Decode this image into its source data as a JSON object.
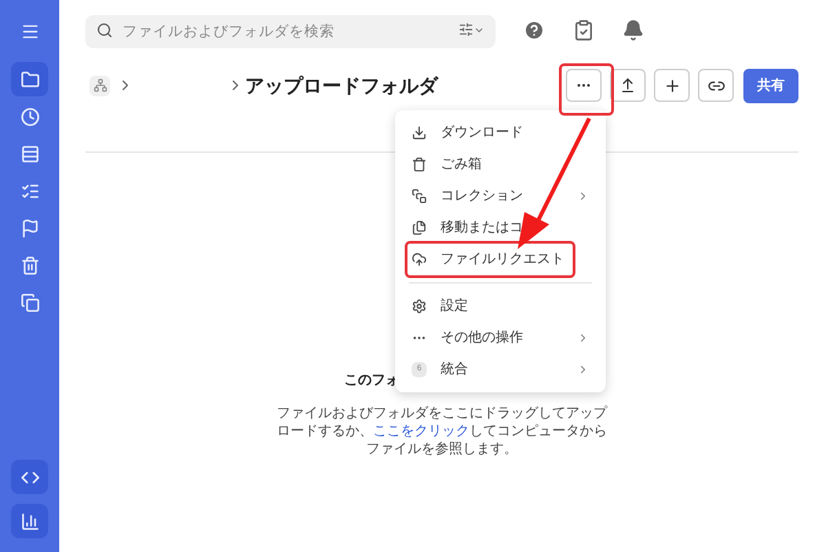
{
  "sidebar": {
    "items": [
      {
        "kind": "folder",
        "selected": true
      },
      {
        "kind": "clock",
        "selected": false
      },
      {
        "kind": "rows",
        "selected": false
      },
      {
        "kind": "list",
        "selected": false
      },
      {
        "kind": "flags",
        "selected": false
      },
      {
        "kind": "bin",
        "selected": false
      },
      {
        "kind": "copy",
        "selected": false
      }
    ],
    "bottom_items": [
      {
        "kind": "code"
      },
      {
        "kind": "chart"
      }
    ]
  },
  "search": {
    "placeholder": "ファイルおよびフォルダを検索"
  },
  "header": {
    "title": "アップロードフォルダ",
    "share_button": "共有"
  },
  "menu": {
    "items": [
      {
        "kind": "download",
        "label": "ダウンロード",
        "submenu": false,
        "highlighted": false
      },
      {
        "kind": "bin",
        "label": "ごみ箱",
        "submenu": false,
        "highlighted": false
      },
      {
        "kind": "collection",
        "label": "コレクション",
        "submenu": true,
        "highlighted": false
      },
      {
        "kind": "copy",
        "label": "移動またはコ",
        "submenu": false,
        "highlighted": false
      },
      {
        "kind": "upload",
        "label": "ファイルリクエスト",
        "submenu": false,
        "highlighted": true
      },
      {
        "kind": "divider"
      },
      {
        "kind": "gear",
        "label": "設定",
        "submenu": false,
        "highlighted": false
      },
      {
        "kind": "dots",
        "label": "その他の操作",
        "submenu": true,
        "highlighted": false
      },
      {
        "kind": "badge",
        "badge": "6",
        "label": "統合",
        "submenu": true,
        "highlighted": false
      }
    ]
  },
  "empty_state": {
    "title": "このフォ",
    "text_before": "ファイルおよびフォルダをここにドラッグしてアップロードするか、",
    "link": "ここをクリック",
    "text_after": "してコンピュータからファイルを参照します。"
  }
}
